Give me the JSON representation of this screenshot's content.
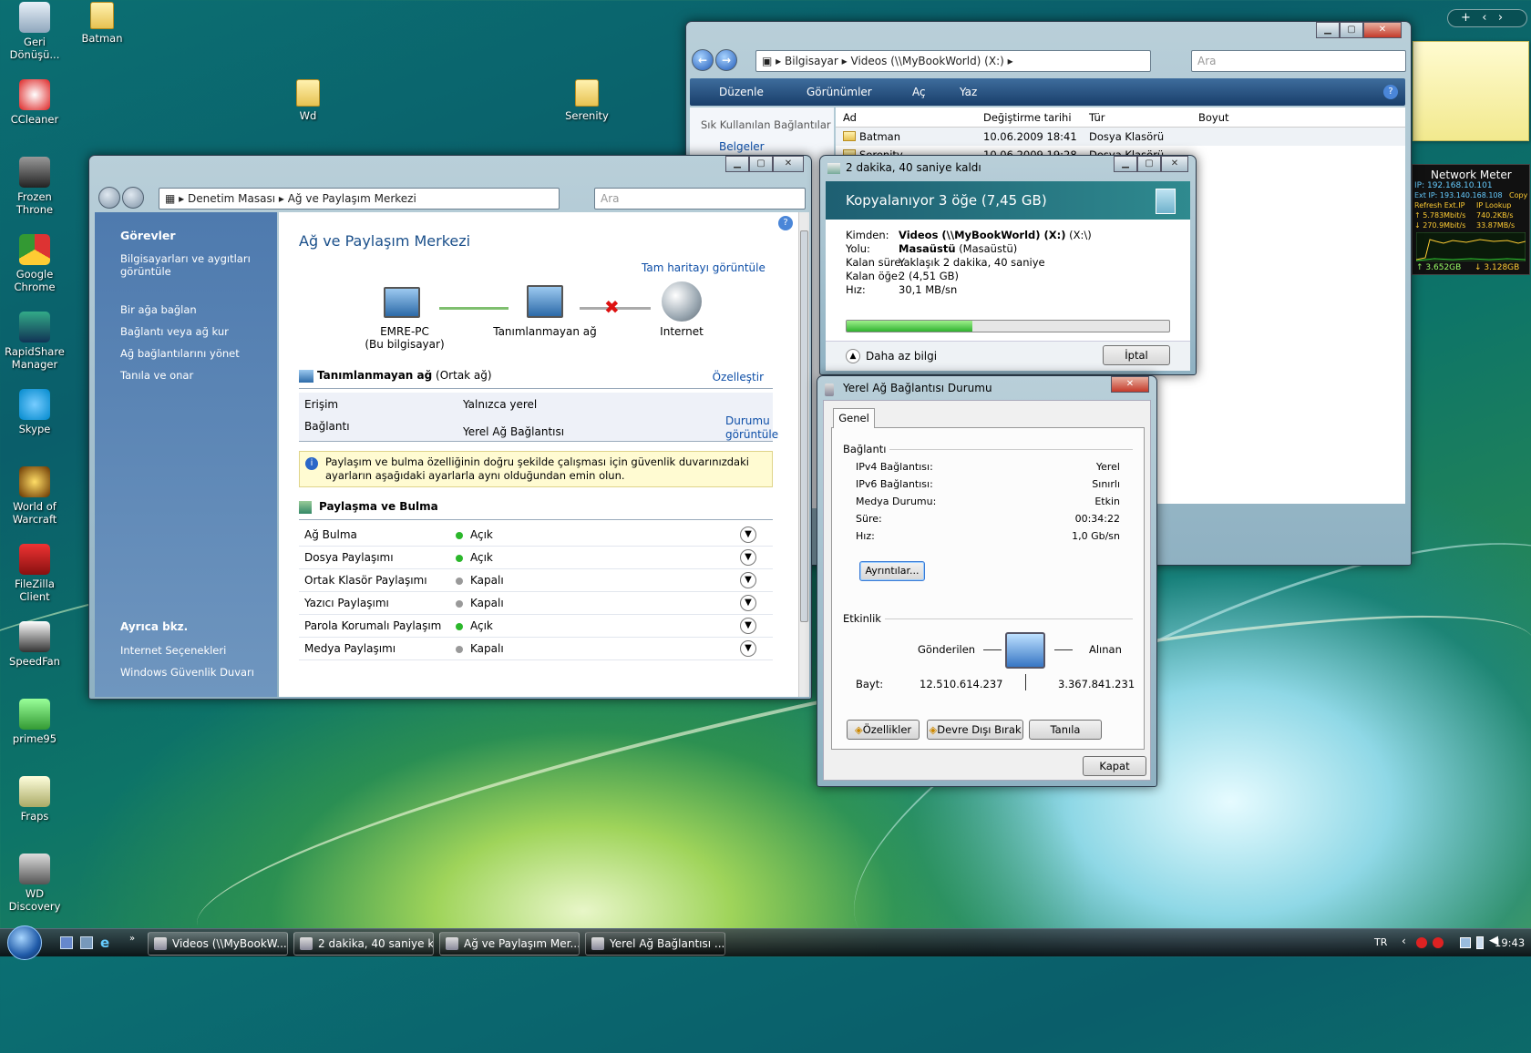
{
  "desktop": {
    "icons": [
      {
        "label": "Geri Dönüşü...",
        "kind": "recycle-bin"
      },
      {
        "label": "Batman",
        "kind": "folder"
      },
      {
        "label": "CCleaner",
        "kind": "ccleaner"
      },
      {
        "label": "Wd",
        "kind": "folder"
      },
      {
        "label": "Serenity",
        "kind": "folder"
      },
      {
        "label": "Frozen Throne",
        "kind": "frozen-throne"
      },
      {
        "label": "Google Chrome",
        "kind": "chrome"
      },
      {
        "label": "RapidShare Manager",
        "kind": "rapidshare"
      },
      {
        "label": "Skype",
        "kind": "skype"
      },
      {
        "label": "World of Warcraft",
        "kind": "wow"
      },
      {
        "label": "FileZilla Client",
        "kind": "filezilla"
      },
      {
        "label": "SpeedFan",
        "kind": "speedfan"
      },
      {
        "label": "prime95",
        "kind": "prime95"
      },
      {
        "label": "Fraps",
        "kind": "fraps"
      },
      {
        "label": "WD Discovery",
        "kind": "wd-discovery"
      }
    ]
  },
  "explorer": {
    "address": [
      "Bilgisayar",
      "Videos (\\\\MyBookWorld) (X:)"
    ],
    "search_placeholder": "Ara",
    "toolbar": [
      "Düzenle",
      "Görünümler",
      "Aç",
      "Yaz"
    ],
    "favorites_title": "Sık Kullanılan Bağlantılar",
    "favorites": [
      "Belgeler"
    ],
    "columns": [
      "Ad",
      "Değiştirme tarihi",
      "Tür",
      "Boyut"
    ],
    "rows": [
      {
        "name": "Batman",
        "date": "10.06.2009 18:41",
        "type": "Dosya Klasörü",
        "size": ""
      },
      {
        "name": "Serenity",
        "date": "10.06.2009 19:28",
        "type": "Dosya Klasörü",
        "size": ""
      }
    ]
  },
  "copy_dialog": {
    "title": "2 dakika, 40 saniye kaldı",
    "heading": "Kopyalanıyor 3 öğe (7,45 GB)",
    "fields": [
      {
        "label": "Kimden:",
        "value": "Videos (\\\\MyBookWorld) (X:)",
        "extra": "(X:\\)"
      },
      {
        "label": "Yolu:",
        "value": "Masaüstü",
        "extra": "(Masaüstü)"
      },
      {
        "label": "Kalan süre:",
        "value": "Yaklaşık 2 dakika, 40 saniye",
        "extra": ""
      },
      {
        "label": "Kalan öğe:",
        "value": "2 (4,51 GB)",
        "extra": ""
      },
      {
        "label": "Hız:",
        "value": "30,1 MB/sn",
        "extra": ""
      }
    ],
    "progress": 0.39,
    "less_info": "Daha az bilgi",
    "cancel": "İptal"
  },
  "network_center": {
    "address": [
      "Denetim Masası",
      "Ağ ve Paylaşım Merkezi"
    ],
    "search_placeholder": "Ara",
    "tasks_title": "Görevler",
    "tasks": [
      "Bilgisayarları ve aygıtları görüntüle",
      "Bir ağa bağlan",
      "Bağlantı veya ağ kur",
      "Ağ bağlantılarını yönet",
      "Tanıla ve onar"
    ],
    "see_also_title": "Ayrıca bkz.",
    "see_also": [
      "Internet Seçenekleri",
      "Windows Güvenlik Duvarı"
    ],
    "title": "Ağ ve Paylaşım Merkezi",
    "full_map": "Tam haritayı görüntüle",
    "map_nodes": [
      {
        "label": "EMRE-PC",
        "sub": "(Bu bilgisayar)"
      },
      {
        "label": "Tanımlanmayan ağ",
        "sub": ""
      },
      {
        "label": "Internet",
        "sub": ""
      }
    ],
    "network_name": "Tanımlanmayan ağ",
    "network_type": "(Ortak ağ)",
    "customize": "Özelleştir",
    "access_label": "Erişim",
    "access_value": "Yalnızca yerel",
    "conn_label": "Bağlantı",
    "conn_value": "Yerel Ağ Bağlantısı",
    "view_status": "Durumu görüntüle",
    "info_text": "Paylaşım ve bulma özelliğinin doğru şekilde çalışması için güvenlik duvarınızdaki ayarların aşağıdaki ayarlarla aynı olduğundan emin olun.",
    "sharing_title": "Paylaşma ve Bulma",
    "sharing": [
      {
        "label": "Ağ Bulma",
        "state": "Açık",
        "on": true
      },
      {
        "label": "Dosya Paylaşımı",
        "state": "Açık",
        "on": true
      },
      {
        "label": "Ortak Klasör Paylaşımı",
        "state": "Kapalı",
        "on": false
      },
      {
        "label": "Yazıcı Paylaşımı",
        "state": "Kapalı",
        "on": false
      },
      {
        "label": "Parola Korumalı Paylaşım",
        "state": "Açık",
        "on": true
      },
      {
        "label": "Medya Paylaşımı",
        "state": "Kapalı",
        "on": false
      }
    ]
  },
  "lan_status": {
    "title": "Yerel Ağ Bağlantısı Durumu",
    "tab": "Genel",
    "conn_group": "Bağlantı",
    "rows": [
      {
        "label": "IPv4 Bağlantısı:",
        "value": "Yerel"
      },
      {
        "label": "IPv6 Bağlantısı:",
        "value": "Sınırlı"
      },
      {
        "label": "Medya Durumu:",
        "value": "Etkin"
      },
      {
        "label": "Süre:",
        "value": "00:34:22"
      },
      {
        "label": "Hız:",
        "value": "1,0 Gb/sn"
      }
    ],
    "details_btn": "Ayrıntılar...",
    "activity_group": "Etkinlik",
    "sent_label": "Gönderilen",
    "received_label": "Alınan",
    "bytes_label": "Bayt:",
    "bytes_sent": "12.510.614.237",
    "bytes_received": "3.367.841.231",
    "buttons": [
      "Özellikler",
      "Devre Dışı Bırak",
      "Tanıla"
    ],
    "close": "Kapat"
  },
  "gadget": {
    "title": "Network Meter",
    "ip": "IP: 192.168.10.101",
    "ext_ip": "Ext IP: 193.140.168.108",
    "copy": "Copy",
    "refresh": "Refresh Ext.IP",
    "lookup": "IP Lookup",
    "up_rate": "5.783Mbit/s",
    "up_rate2": "740.2KB/s",
    "down_rate": "270.9Mbit/s",
    "down_rate2": "33.87MB/s",
    "up_total": "3.652GB",
    "down_total": "3.128GB"
  },
  "taskbar": {
    "tasks": [
      "Videos (\\\\MyBookW...",
      "2 dakika, 40 saniye k...",
      "Ağ ve Paylaşım Mer...",
      "Yerel Ağ Bağlantısı ..."
    ],
    "lang": "TR",
    "clock": "19:43"
  }
}
